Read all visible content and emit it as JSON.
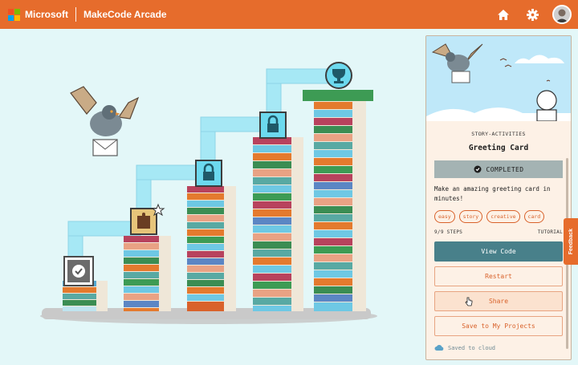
{
  "header": {
    "brand": "Microsoft",
    "app_title": "MakeCode Arcade",
    "icons": [
      "home-icon",
      "gear-icon"
    ],
    "colors": {
      "bar": "#e66c2c"
    }
  },
  "map": {
    "levels": [
      {
        "status": "completed",
        "icon": "checkmark-icon"
      },
      {
        "status": "current",
        "icon": "puzzle-icon"
      },
      {
        "status": "locked",
        "icon": "lock-icon"
      },
      {
        "status": "locked",
        "icon": "lock-icon"
      },
      {
        "status": "goal",
        "icon": "trophy-icon"
      }
    ]
  },
  "sidebar": {
    "kicker": "STORY-ACTIVITIES",
    "title": "Greeting Card",
    "status": "COMPLETED",
    "description": "Make an amazing greeting card in minutes!",
    "tags": [
      "easy",
      "story",
      "creative",
      "card"
    ],
    "steps": "9/9 STEPS",
    "type": "TUTORIAL",
    "buttons": {
      "view_code": "View Code",
      "restart": "Restart",
      "share": "Share",
      "save": "Save to My Projects"
    },
    "saved": "Saved to cloud"
  },
  "feedback": "Feedback"
}
